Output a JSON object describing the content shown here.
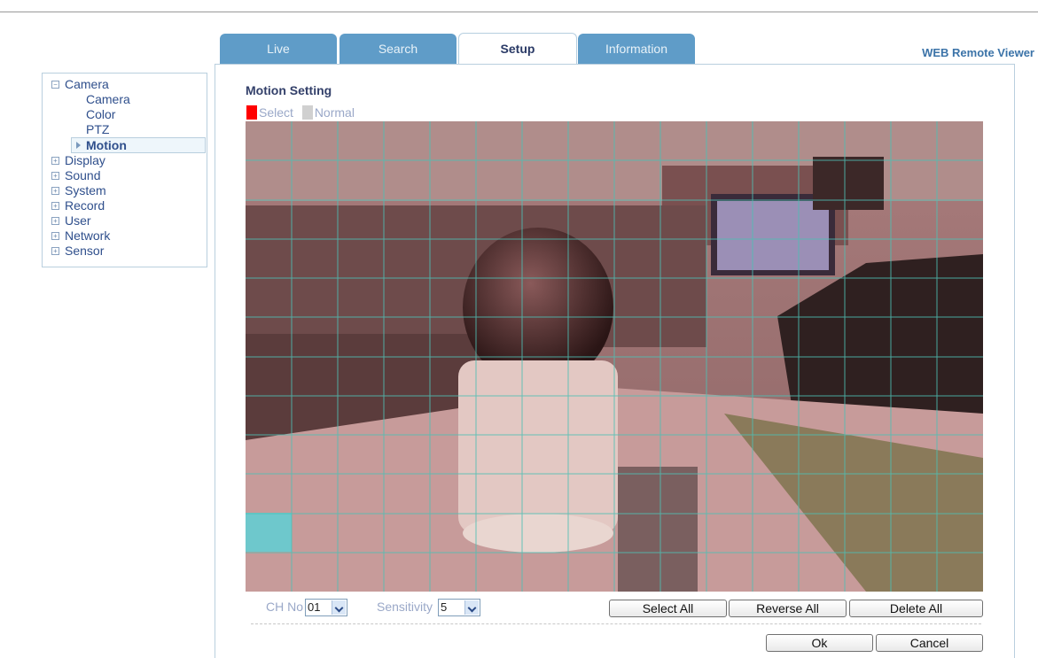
{
  "tabs": [
    {
      "label": "Live",
      "active": false
    },
    {
      "label": "Search",
      "active": false
    },
    {
      "label": "Setup",
      "active": true
    },
    {
      "label": "Information",
      "active": false
    }
  ],
  "brand": "WEB Remote Viewer",
  "sidebar": {
    "camera": "Camera",
    "camera_items": [
      "Camera",
      "Color",
      "PTZ",
      "Motion"
    ],
    "selected": "Motion",
    "others": [
      "Display",
      "Sound",
      "System",
      "Record",
      "User",
      "Network",
      "Sensor"
    ]
  },
  "motion": {
    "title": "Motion Setting",
    "legend_select": "Select",
    "legend_normal": "Normal",
    "select_color": "#ff0000",
    "normal_color": "#d0d0d0",
    "grid": {
      "cols": 16,
      "rows": 12,
      "selected_cells": [
        [
          0,
          10
        ]
      ],
      "selected_cell_color": "#6ec8cc"
    }
  },
  "controls": {
    "ch_label": "CH No",
    "ch_value": "01",
    "sensitivity_label": "Sensitivity",
    "sensitivity_value": "5",
    "select_all": "Select All",
    "reverse_all": "Reverse All",
    "delete_all": "Delete All",
    "ok": "Ok",
    "cancel": "Cancel"
  },
  "colors": {
    "tab_bg": "#5f9cc8",
    "accent": "#3b73a8",
    "grid_line": "#4fbfb4"
  }
}
